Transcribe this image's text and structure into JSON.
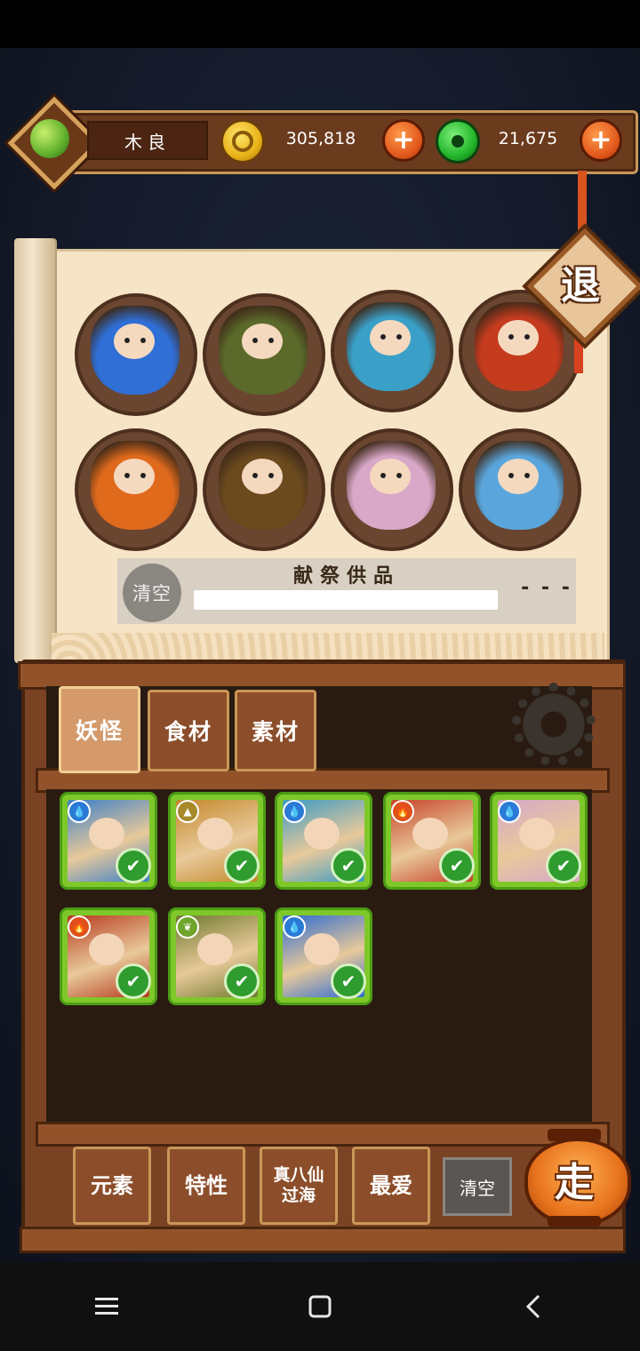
{
  "player": {
    "name": "木良"
  },
  "resources": {
    "gold": "305,818",
    "jade": "21,675",
    "plus_label": "+"
  },
  "exit_label": "退",
  "altar": {
    "portraits": [
      {
        "theme": "#2f6fd6"
      },
      {
        "theme": "#5b6a2a"
      },
      {
        "theme": "#3aa0c8"
      },
      {
        "theme": "#c43b1e"
      },
      {
        "theme": "#e06a1c"
      },
      {
        "theme": "#6b4a1e"
      },
      {
        "theme": "#d9a8c8"
      },
      {
        "theme": "#5aa6dc"
      }
    ],
    "clear_label": "清空",
    "offer_title": "献祭供品",
    "offer_count": "- - -"
  },
  "tabs": [
    "妖怪",
    "食材",
    "素材"
  ],
  "cards": [
    {
      "theme": "#3c7fc8",
      "element": "water-drop-icon",
      "element_color": "#2a7ad6",
      "checked": true
    },
    {
      "theme": "#c4882a",
      "element": "earth-triangle-icon",
      "element_color": "#a68a2a",
      "checked": true
    },
    {
      "theme": "#3a9ac4",
      "element": "water-drop-icon",
      "element_color": "#2a7ad6",
      "checked": true
    },
    {
      "theme": "#c7432a",
      "element": "fire-icon",
      "element_color": "#e0501a",
      "checked": true
    },
    {
      "theme": "#d6a8c8",
      "element": "water-drop-icon",
      "element_color": "#2a7ad6",
      "checked": true
    },
    {
      "theme": "#b63a1e",
      "element": "fire-icon",
      "element_color": "#e0501a",
      "checked": true
    },
    {
      "theme": "#6f7a2e",
      "element": "leaf-icon",
      "element_color": "#6ea42a",
      "checked": true
    },
    {
      "theme": "#2c6ad2",
      "element": "water-drop-icon",
      "element_color": "#2a7ad6",
      "checked": true
    }
  ],
  "bottom_buttons": {
    "element": "元素",
    "trait": "特性",
    "eight_immortals": "真八仙\n过海",
    "favorite": "最爱",
    "clear": "清空",
    "go": "走"
  },
  "colors": {
    "frame": "#7a4424",
    "card_border": "#7fc82a",
    "check": "#2e9c2e"
  }
}
